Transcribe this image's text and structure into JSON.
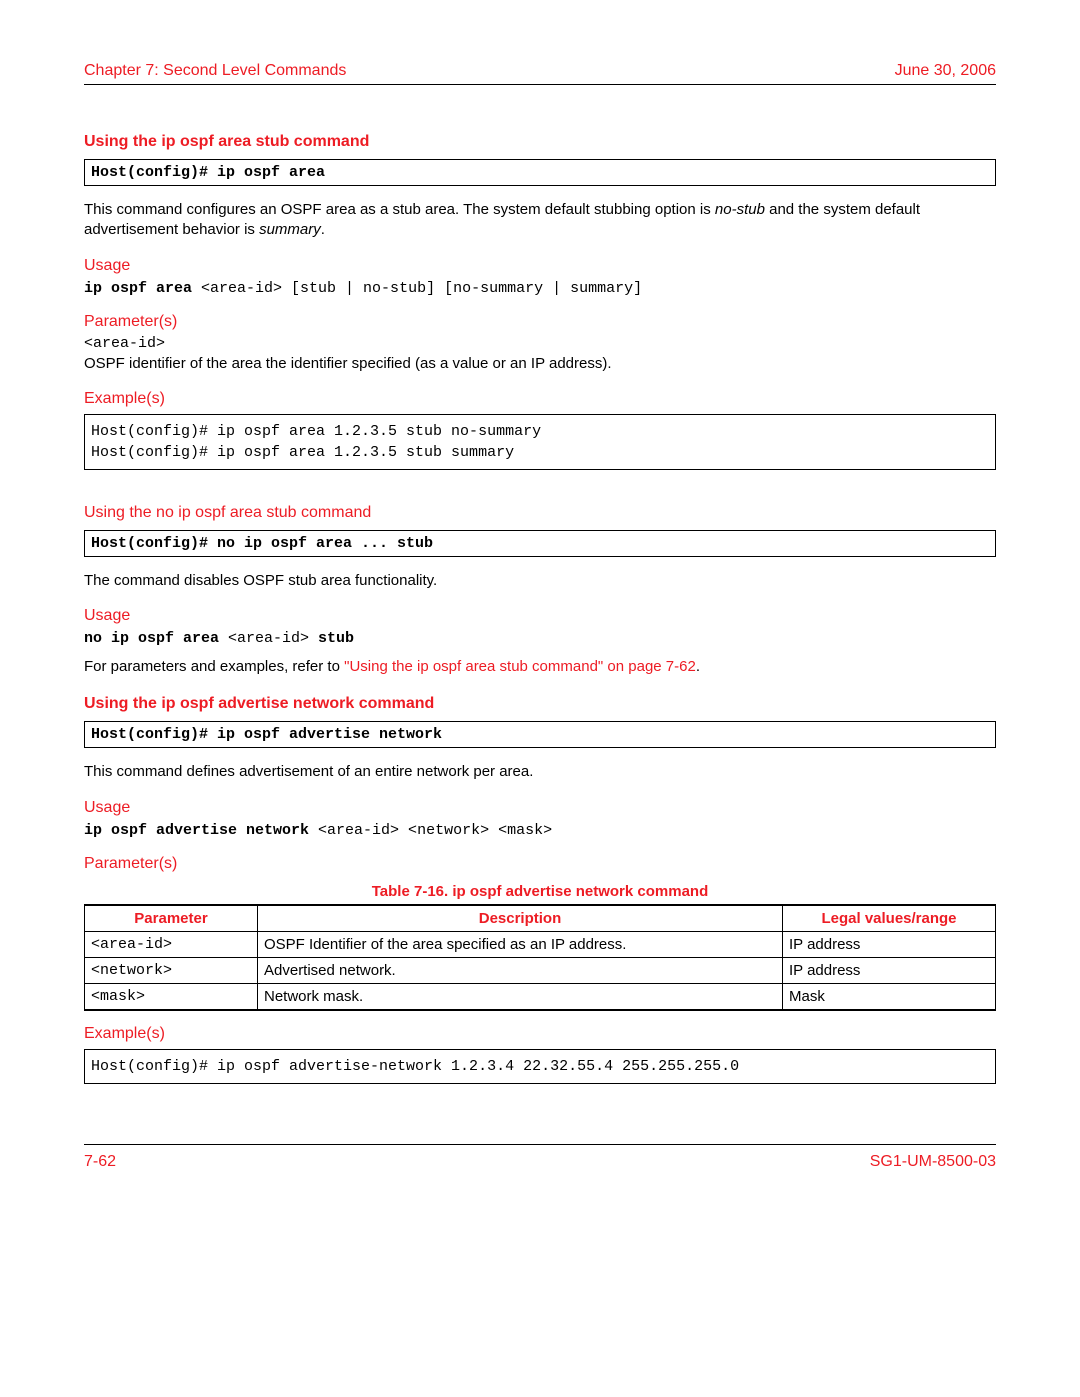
{
  "header": {
    "left": "Chapter 7: Second Level Commands",
    "right": "June 30, 2006"
  },
  "footer": {
    "left": "7-62",
    "right": "SG1-UM-8500-03"
  },
  "s1": {
    "title": "Using the ip ospf area stub command",
    "cmdbox": "Host(config)# ip ospf area",
    "intro_a": "This command configures an OSPF area as a stub area. The system default stubbing option is ",
    "intro_b": "no-stub",
    "intro_c": " and the system default advertisement behavior is ",
    "intro_d": "summary",
    "intro_e": ".",
    "usage_label": "Usage",
    "usage_b": "ip ospf area ",
    "usage_r": "<area-id> [stub | no-stub] [no-summary | summary]",
    "params_label": "Parameter(s)",
    "param_name": "<area-id>",
    "param_desc": "OSPF identifier of the area the identifier specified (as a value or an IP address).",
    "ex_label": "Example(s)",
    "ex_box": "Host(config)# ip ospf area 1.2.3.5 stub no-summary\nHost(config)# ip ospf area 1.2.3.5 stub summary"
  },
  "s2": {
    "title": "Using the no ip ospf area stub command",
    "cmdbox": "Host(config)# no ip ospf area ... stub",
    "intro": "The command disables OSPF stub area functionality.",
    "usage_label": "Usage",
    "usage_b1": "no ip ospf area ",
    "usage_r1": "<area-id>",
    "usage_b2": " stub",
    "ref_a": "For parameters and examples, refer to ",
    "ref_link": "\"Using the ip ospf area stub command\" on page 7-62",
    "ref_c": "."
  },
  "s3": {
    "title": "Using the ip ospf advertise network command",
    "cmdbox": "Host(config)# ip ospf advertise network",
    "intro": "This command defines advertisement of an entire network per area.",
    "usage_label": "Usage",
    "usage_b": "ip ospf advertise network ",
    "usage_r": "<area-id> <network> <mask>",
    "params_label": "Parameter(s)",
    "table": {
      "caption": "Table 7-16. ip ospf advertise network command",
      "h1": "Parameter",
      "h2": "Description",
      "h3": "Legal values/range",
      "r1c1": "<area-id>",
      "r1c2": "OSPF Identifier of the area specified as an IP address.",
      "r1c3": "IP address",
      "r2c1": "<network>",
      "r2c2": "Advertised network.",
      "r2c3": "IP address",
      "r3c1": "<mask>",
      "r3c2": "Network mask.",
      "r3c3": "Mask"
    },
    "ex_label": "Example(s)",
    "ex_box": "Host(config)# ip ospf advertise-network 1.2.3.4 22.32.55.4 255.255.255.0"
  }
}
